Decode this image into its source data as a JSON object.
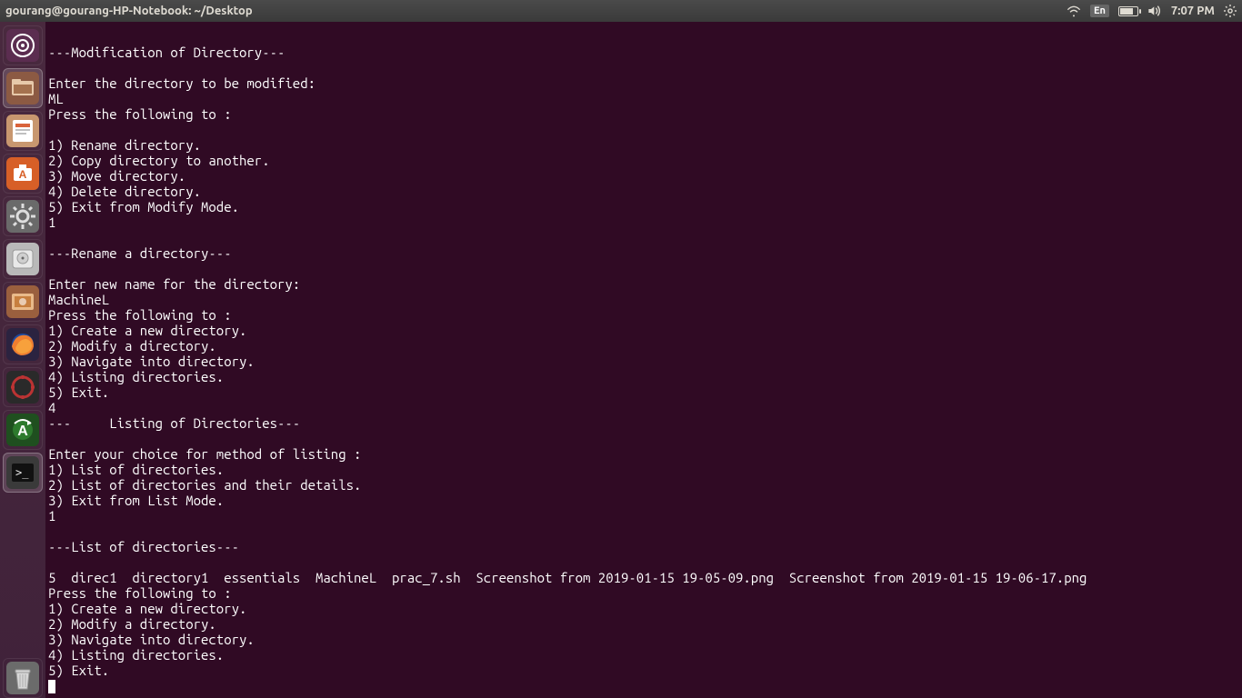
{
  "top_panel": {
    "window_title": "gourang@gourang-HP-Notebook: ~/Desktop",
    "lang": "En",
    "clock": "7:07 PM"
  },
  "launcher": {
    "items": [
      {
        "name": "dash",
        "color_bg": "#dd4814"
      },
      {
        "name": "files",
        "color_bg": "#b05f3a",
        "selected": true
      },
      {
        "name": "libreoffice-impress",
        "color_bg": "#d0704a"
      },
      {
        "name": "ubuntu-software",
        "color_bg": "#d75f27"
      },
      {
        "name": "settings",
        "color_bg": "#6f6f6f"
      },
      {
        "name": "disks",
        "color_bg": "#c8c8c8"
      },
      {
        "name": "screenshot",
        "color_bg": "#b9683d"
      },
      {
        "name": "firefox",
        "color_bg": "#ef7e2f"
      },
      {
        "name": "updates",
        "color_bg": "#222222"
      },
      {
        "name": "software-updater",
        "color_bg": "#1f6b1f"
      },
      {
        "name": "terminal",
        "color_bg": "#2c2c2c",
        "selected": true
      }
    ],
    "trash_name": "trash"
  },
  "terminal": {
    "lines": [
      "",
      "---Modification of Directory---",
      "",
      "Enter the directory to be modified:",
      "ML",
      "Press the following to :",
      "",
      "1) Rename directory.",
      "2) Copy directory to another.",
      "3) Move directory.",
      "4) Delete directory.",
      "5) Exit from Modify Mode.",
      "1",
      "",
      "---Rename a directory---",
      "",
      "Enter new name for the directory:",
      "MachineL",
      "Press the following to :",
      "1) Create a new directory.",
      "2) Modify a directory.",
      "3) Navigate into directory.",
      "4) Listing directories.",
      "5) Exit.",
      "4",
      "---     Listing of Directories---",
      "",
      "Enter your choice for method of listing :",
      "1) List of directories.",
      "2) List of directories and their details.",
      "3) Exit from List Mode.",
      "1",
      "",
      "---List of directories---",
      "",
      "5  direc1  directory1  essentials  MachineL  prac_7.sh  Screenshot from 2019-01-15 19-05-09.png  Screenshot from 2019-01-15 19-06-17.png",
      "Press the following to :",
      "1) Create a new directory.",
      "2) Modify a directory.",
      "3) Navigate into directory.",
      "4) Listing directories.",
      "5) Exit."
    ]
  }
}
